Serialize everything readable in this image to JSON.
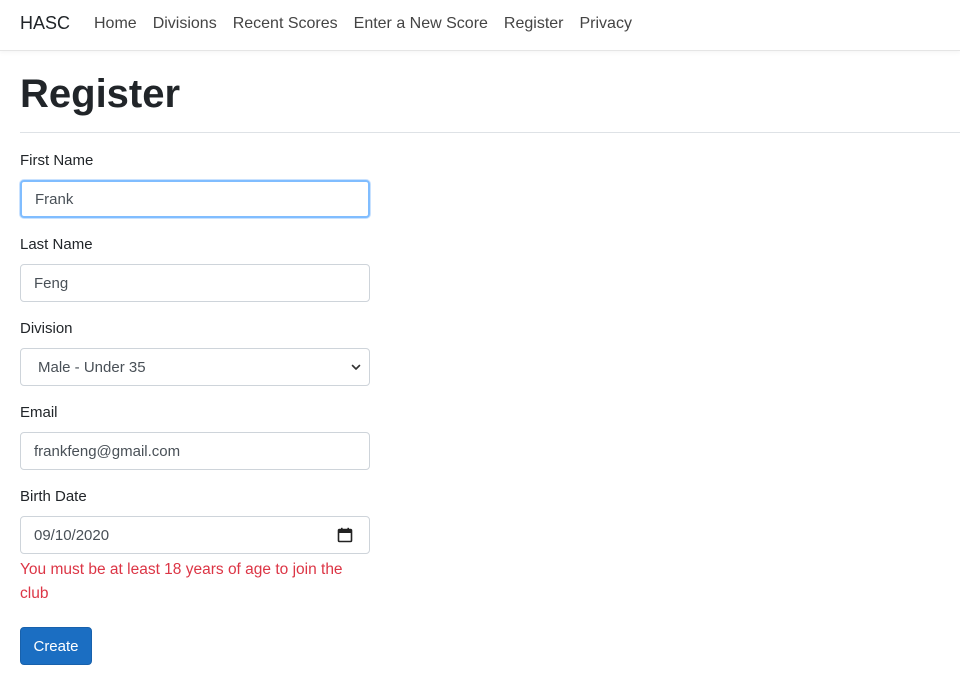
{
  "navbar": {
    "brand": "HASC",
    "items": [
      {
        "label": "Home"
      },
      {
        "label": "Divisions"
      },
      {
        "label": "Recent Scores"
      },
      {
        "label": "Enter a New Score"
      },
      {
        "label": "Register"
      },
      {
        "label": "Privacy"
      }
    ]
  },
  "page": {
    "title": "Register"
  },
  "form": {
    "first_name": {
      "label": "First Name",
      "value": "Frank"
    },
    "last_name": {
      "label": "Last Name",
      "value": "Feng"
    },
    "division": {
      "label": "Division",
      "value": "Male - Under 35"
    },
    "email": {
      "label": "Email",
      "value": "frankfeng@gmail.com"
    },
    "birth_date": {
      "label": "Birth Date",
      "value": "09/10/2020",
      "error": "You must be at least 18 years of age to join the club"
    },
    "submit_label": "Create"
  },
  "colors": {
    "primary": "#1b6ec2",
    "error": "#dc3545",
    "focus": "#80bdff"
  },
  "icons": {
    "select": "chevron-down-icon",
    "date": "calendar-icon"
  }
}
